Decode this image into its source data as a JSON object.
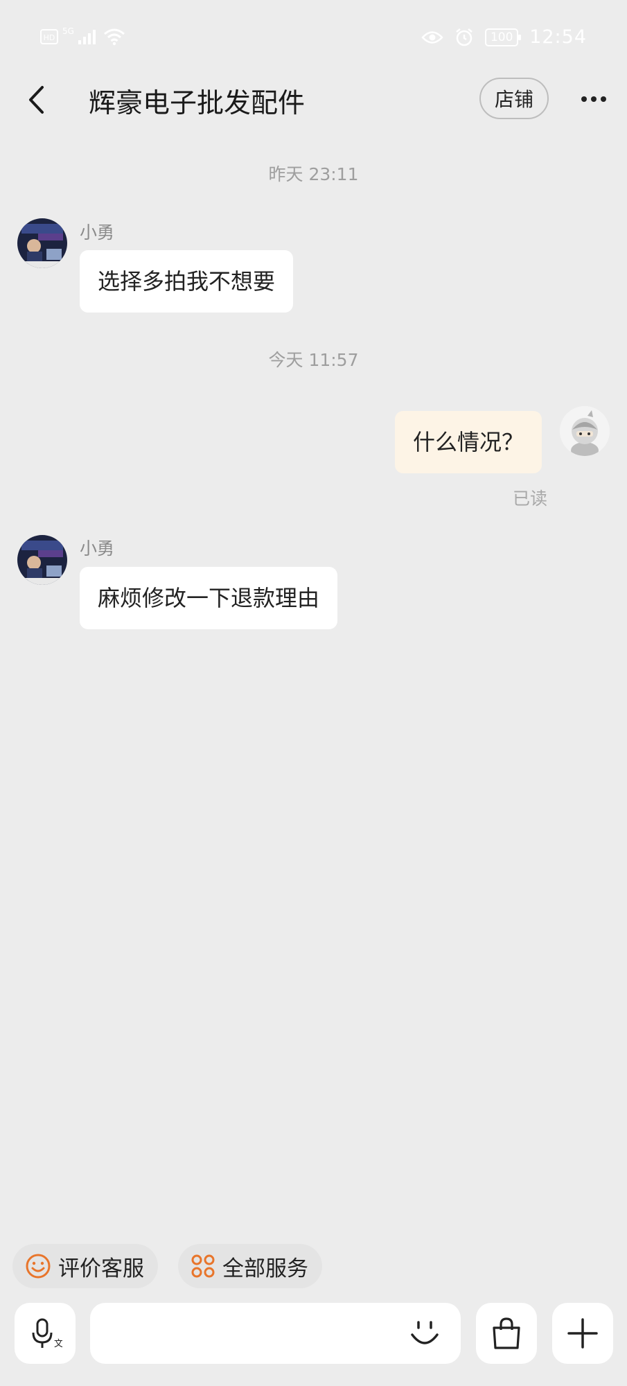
{
  "status_bar": {
    "network_left": "HD",
    "network_gen": "5G",
    "battery": "100",
    "time": "12:54"
  },
  "header": {
    "title": "辉豪电子批发配件",
    "shop_label": "店铺"
  },
  "messages": [
    {
      "type": "time",
      "text": "昨天  23:11"
    },
    {
      "type": "incoming",
      "sender": "小勇",
      "text": "选择多拍我不想要"
    },
    {
      "type": "time",
      "text": "今天  11:57"
    },
    {
      "type": "outgoing",
      "text": "什么情况？",
      "status": "已读"
    },
    {
      "type": "incoming",
      "sender": "小勇",
      "text": "麻烦修改一下退款理由"
    }
  ],
  "quick_actions": [
    {
      "label": "评价客服",
      "icon": "smiley-icon"
    },
    {
      "label": "全部服务",
      "icon": "grid-icon"
    }
  ],
  "input": {
    "placeholder": ""
  },
  "colors": {
    "accent": "#e8752b",
    "outgoing_bubble": "#fdf4e6",
    "background": "#ececec"
  }
}
